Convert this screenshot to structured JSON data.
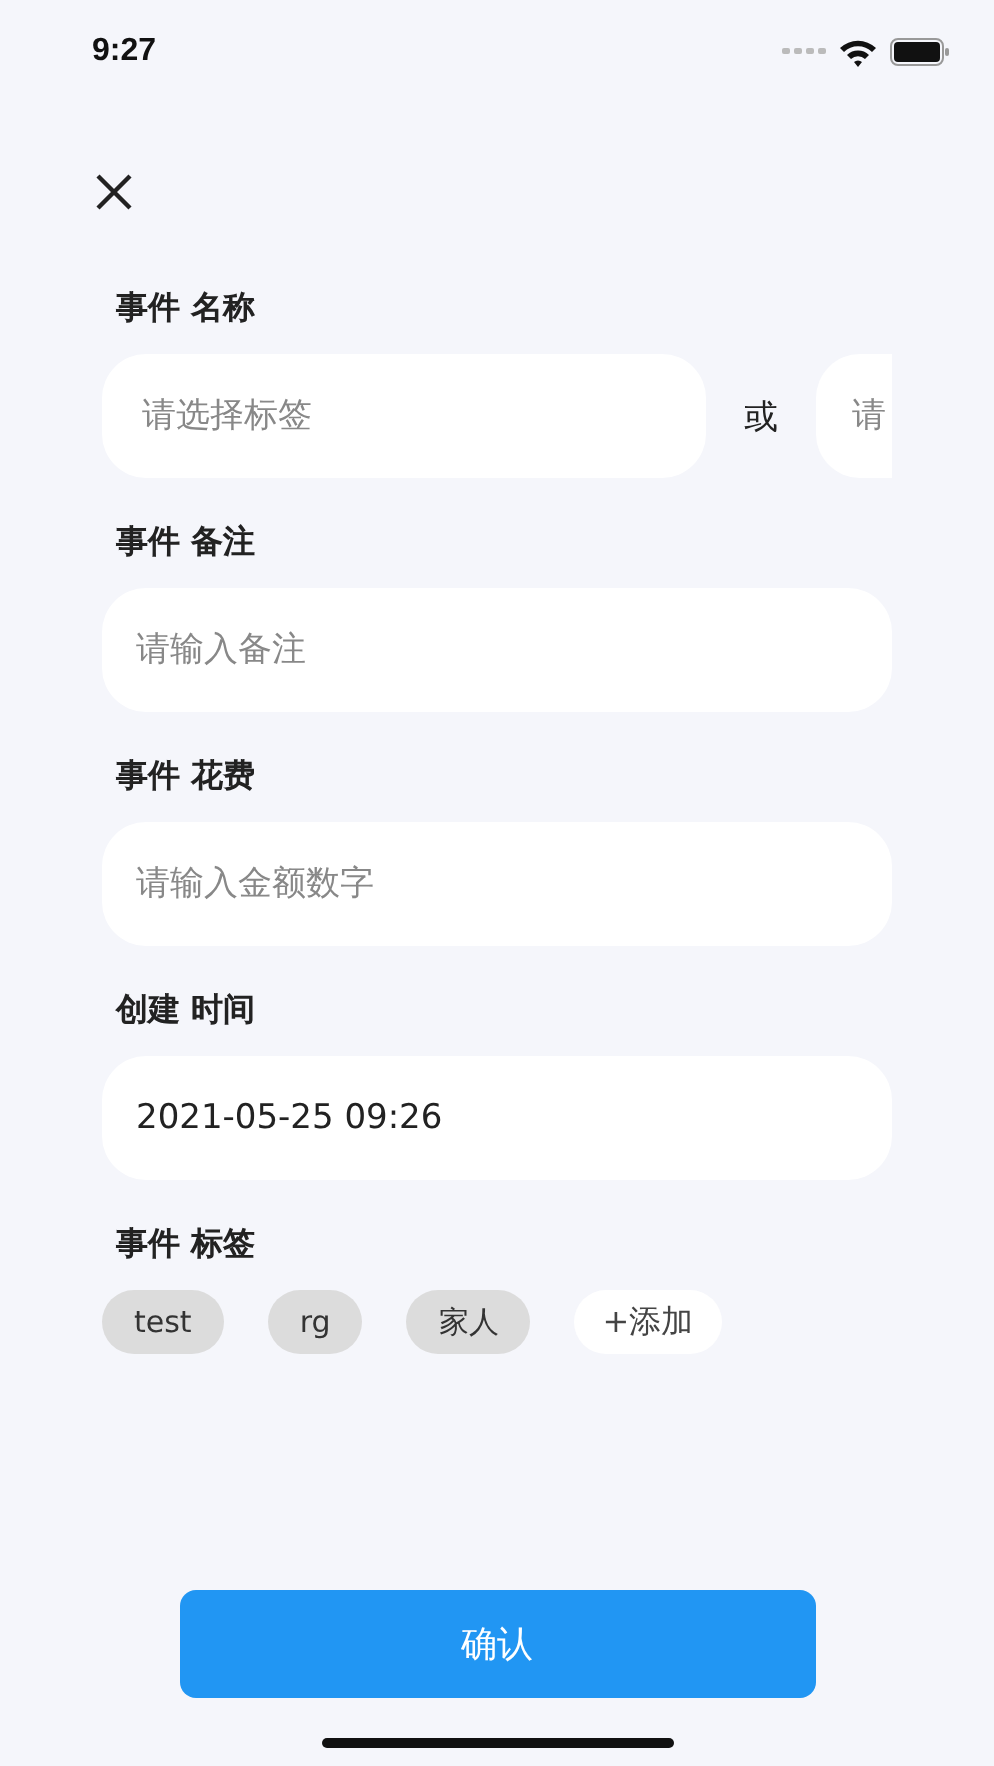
{
  "status_bar": {
    "time": "9:27"
  },
  "sections": [
    {
      "label": "事件 名称",
      "kind": "choice",
      "placeholder": "请选择标签",
      "separator": "或",
      "alt_placeholder": "请"
    },
    {
      "label": "事件 备注",
      "kind": "input",
      "placeholder": "请输入备注"
    },
    {
      "label": "事件 花费",
      "kind": "input",
      "placeholder": "请输入金额数字"
    },
    {
      "label": "创建 时间",
      "kind": "input",
      "value": "2021-05-25 09:26"
    },
    {
      "label": "事件 标签",
      "kind": "tags",
      "tags": [
        "test",
        "rg",
        "家人"
      ],
      "add_label": "+添加"
    }
  ],
  "confirm_button": "确认"
}
